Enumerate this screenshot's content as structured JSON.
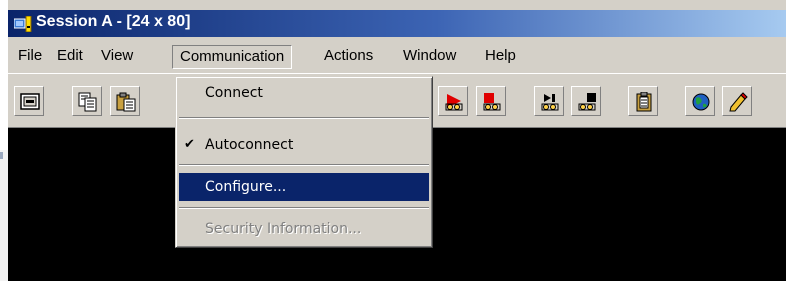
{
  "window": {
    "title": "Session A - [24 x 80]"
  },
  "menubar": {
    "items": [
      {
        "label": "File"
      },
      {
        "label": "Edit"
      },
      {
        "label": "View"
      },
      {
        "label": "Communication",
        "open": true
      },
      {
        "label": "Actions"
      },
      {
        "label": "Window"
      },
      {
        "label": "Help"
      }
    ]
  },
  "toolbar": {
    "buttons": [
      {
        "icon": "display-icon"
      },
      {
        "icon": "copy-icon"
      },
      {
        "icon": "paste-icon"
      },
      {
        "icon": "record-macro-icon"
      },
      {
        "icon": "stop-macro-icon"
      },
      {
        "icon": "play-macro-icon"
      },
      {
        "icon": "macro-icon"
      },
      {
        "icon": "clipboard-icon"
      },
      {
        "icon": "globe-icon"
      },
      {
        "icon": "edit-icon"
      }
    ]
  },
  "communication_menu": {
    "items": [
      {
        "label": "Connect",
        "checked": false,
        "highlighted": false,
        "enabled": true
      },
      {
        "label": "Autoconnect",
        "checked": true,
        "highlighted": false,
        "enabled": true
      },
      {
        "label": "Configure...",
        "checked": false,
        "highlighted": true,
        "enabled": true
      },
      {
        "label": "Security Information...",
        "checked": false,
        "highlighted": false,
        "enabled": false
      }
    ],
    "check_glyph": "✔"
  },
  "colors": {
    "title_bar_start": "#0a246a",
    "title_bar_end": "#a6caf0",
    "highlight": "#0a246a",
    "chrome": "#d4d0c8",
    "terminal": "#000000"
  }
}
